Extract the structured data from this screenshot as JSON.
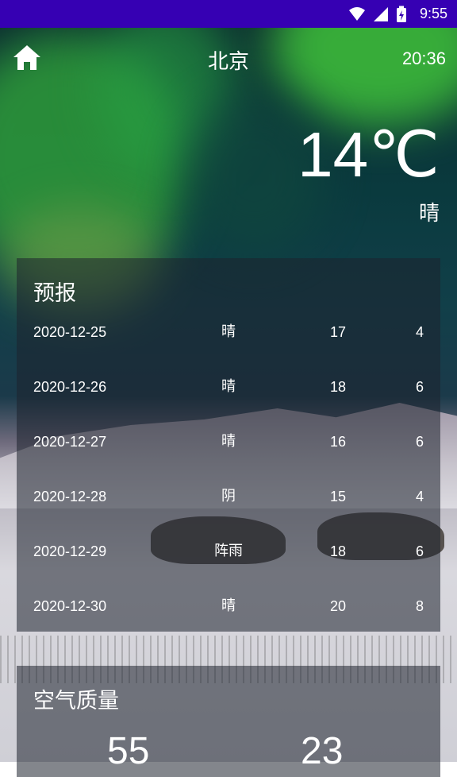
{
  "status_bar": {
    "time": "9:55",
    "icons": [
      "wifi-icon",
      "signal-icon",
      "battery-charging-icon"
    ],
    "background_color": "#3600b3"
  },
  "app_bar": {
    "home_icon": "home-icon",
    "city": "北京",
    "update_time": "20:36"
  },
  "now": {
    "temperature": "14℃",
    "info": "晴"
  },
  "forecast": {
    "title": "预报",
    "rows": [
      {
        "date": "2020-12-25",
        "info": "晴",
        "max": "17",
        "min": "4"
      },
      {
        "date": "2020-12-26",
        "info": "晴",
        "max": "18",
        "min": "6"
      },
      {
        "date": "2020-12-27",
        "info": "晴",
        "max": "16",
        "min": "6"
      },
      {
        "date": "2020-12-28",
        "info": "阴",
        "max": "15",
        "min": "4"
      },
      {
        "date": "2020-12-29",
        "info": "阵雨",
        "max": "18",
        "min": "6"
      },
      {
        "date": "2020-12-30",
        "info": "晴",
        "max": "20",
        "min": "8"
      }
    ]
  },
  "aqi": {
    "title": "空气质量",
    "aqi_value": "55",
    "pm25_value": "23"
  }
}
